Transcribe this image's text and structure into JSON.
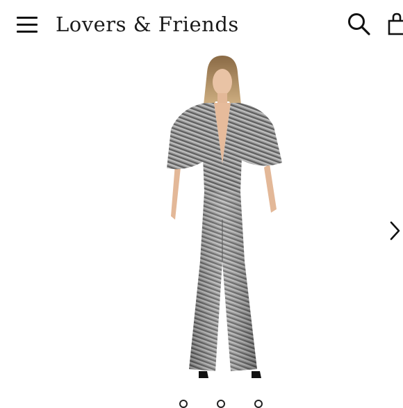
{
  "header": {
    "brand": "Lovers & Friends",
    "menu_icon": "hamburger-menu-icon",
    "search_icon": "search-icon",
    "bag_icon": "shopping-bag-icon"
  },
  "product": {
    "image_alt": "model wearing a metallic silver plunging wide-leg jumpsuit with cape sleeves"
  },
  "carousel": {
    "next_icon": "chevron-right-icon",
    "page_count": 3
  },
  "colors": {
    "text": "#1b1b1b",
    "background": "#ffffff",
    "fabric_silver": "#a9a9a9",
    "fabric_dark": "#4a4a4a"
  }
}
